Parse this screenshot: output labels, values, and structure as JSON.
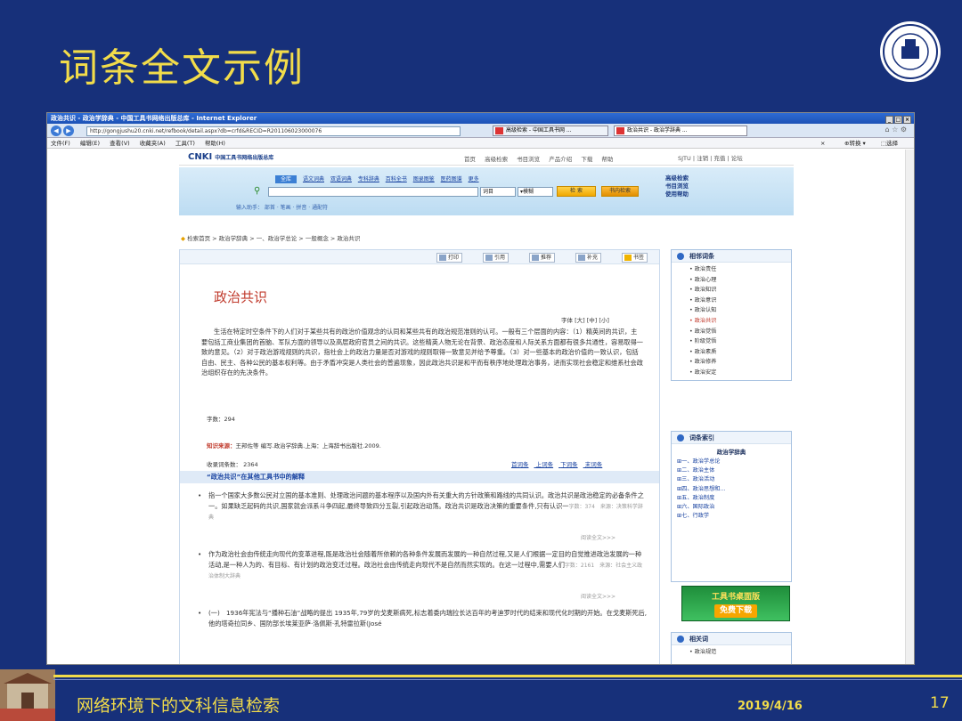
{
  "slide": {
    "title": "词条全文示例",
    "footer_text": "网络环境下的文科信息检索",
    "date": "2019/4/16",
    "page_number": "17",
    "accent_color": "#f2dc4a",
    "bg_color": "#17307a"
  },
  "browser": {
    "window_title": "政治共识 - 政治学辞典 - 中国工具书网络出版总库 - Internet Explorer",
    "url": "http://gongjushu20.cnki.net/refbook/detail.aspx?db=crfd&RECID=R201106023000076",
    "tabs": [
      "高级检索 - 中国工具书网 ...",
      "政治共识 - 政治学辞典 ..."
    ],
    "menu": [
      "文件(F)",
      "编辑(E)",
      "查看(V)",
      "收藏夹(A)",
      "工具(T)",
      "帮助(H)"
    ],
    "menu_right": [
      "转换",
      "选择"
    ]
  },
  "site": {
    "logo": "CNKI",
    "logo_sub": "中国工具书网络出版总库",
    "top_links": [
      "首页",
      "高级检索",
      "书目浏览",
      "产品介绍",
      "下载",
      "帮助"
    ],
    "right_links": "SJTU | 注销 | 充值 | 论坛",
    "search_tabs": [
      "全库",
      "语文词典",
      "双语词典",
      "专科辞典",
      "百科全书",
      "图录图鉴",
      "医药图谱",
      "更多"
    ],
    "search_field": "词目",
    "search_mode": "模糊",
    "search_button": "检 索",
    "search_in_book_button": "书内检索",
    "search_help": "输入助手： 部首 · 笔画 · 拼音 · 通配符",
    "side_links": [
      "高级检索",
      "书目浏览",
      "使用帮助"
    ],
    "breadcrumb": "检索首页 > 政治学辞典 > 一、政治学总论 > 一般概念 > 政治共识"
  },
  "article": {
    "toolbar": [
      "打印",
      "引用",
      "推荐",
      "补充",
      "书签"
    ],
    "term": "政治共识",
    "font_size_label": "字体 [大] [中] [小]",
    "body": "生活在特定时空条件下的人们对于某些共有的政治价值观念的认同和某些共有的政治规范准则的认可。一般有三个层面的内容：（1）精英间的共识，主要包括工商业集团的首脑、军队方面的领导以及高层政府官员之间的共识。这些精英人物无论在背景、政治态度和人际关系方面都有很多共通性，容易取得一致的意见。（2）对于政治游戏规则的共识，指社会上的政治力量是否对游戏的规则取得一致意见并给予尊重。（3）对一些基本的政治价值的一致认识，包括自由、民主、各种公民的基本权利等。由于矛盾冲突是人类社会的普遍现象，因此政治共识是和平而有秩序地处理政治事务，进而实现社会稳定和维系社会政治组织存在的先决条件。",
    "word_count": "字数：294",
    "source_label": "知识来源：",
    "source": "王邦佐等 编写.政治学辞典.上海：上海辞书出版社.2009.",
    "entry_count": "收录词条数： 2364",
    "pager": [
      "首词条",
      "上词条",
      "下词条",
      "末词条"
    ],
    "other_header": "“政治共识”在其他工具书中的解释",
    "others": [
      {
        "text": "指一个国家大多数公民对立国的基本准则、处理政治问题的基本程序以及国内外有关重大的方针政策和路线的共同认识。政治共识是政治稳定的必备条件之一。如果缺乏起码的共识,国家就会派系斗争四起,最终导致四分五裂,引起政治动荡。政治共识是政治决策的重要条件,只有认识一",
        "meta": "字数：374　来源：决策科学辞典",
        "more": "阅读全文>>>"
      },
      {
        "text": "作为政治社会由传统走向现代的变革进程,既是政治社会随着所依赖的各种条件发展而发展的一种自然过程,又是人们根据一定目的自觉推进政治发展的一种活动,是一种人为的、有目标、有计划的政治变迁过程。政治社会由传统走向现代不是自然而然实现的。在这一过程中,需要人们",
        "meta": "字数：2161　来源：社会主义政治体制大辞典",
        "more": "阅读全文>>>"
      },
      {
        "text": "(一)　1936年宪法与“播种石油”战略的提出 1935年,79岁的戈麦斯病死,标志着委内瑞拉长达百年的考迪罗时代的结束和现代化时期的开始。在戈麦斯死后,他的塔奇拉同乡、国防部长埃莱亚萨·洛佩斯·孔特雷拉斯(José",
        "meta": "",
        "more": ""
      }
    ]
  },
  "sidebar": {
    "related_title": "相邻词条",
    "related": [
      "政治责任",
      "政治心理",
      "政治知识",
      "政治意识",
      "政治认知",
      "政治共识",
      "政治觉悟",
      "阶级觉悟",
      "政治素质",
      "政治修养",
      "政治安定"
    ],
    "current": "政治共识",
    "index_title": "词条索引",
    "index_book": "政治学辞典",
    "index": [
      "一、政治学总论",
      "二、政治主体",
      "三、政治活动",
      "四、政治思想和...",
      "五、政治制度",
      "六、国际政治",
      "七、行政学"
    ],
    "ad_line1": "工具书桌面版",
    "ad_line2": "免费下载",
    "rel_title": "相关词",
    "rel": [
      "政治规范"
    ]
  }
}
